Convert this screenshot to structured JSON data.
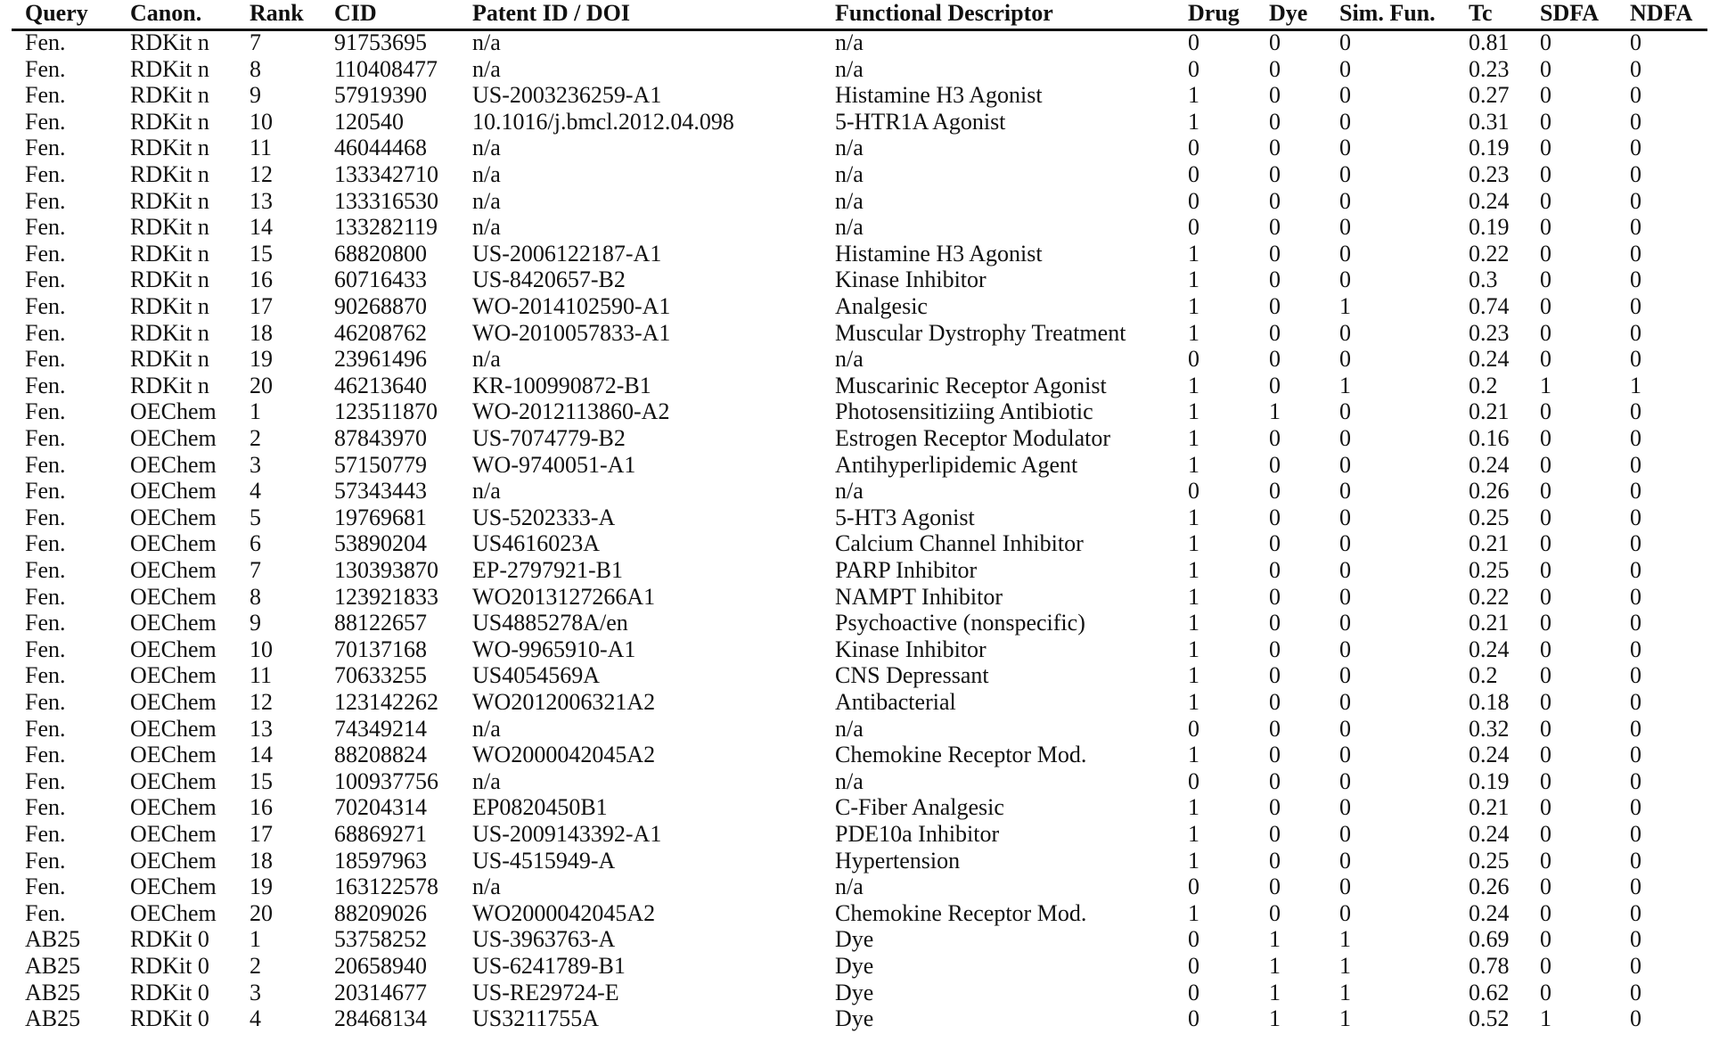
{
  "table": {
    "headers": [
      "Query",
      "Canon.",
      "Rank",
      "CID",
      "Patent ID / DOI",
      "Functional Descriptor",
      "Drug",
      "Dye",
      "Sim. Fun.",
      "Tc",
      "SDFA",
      "NDFA"
    ],
    "rows": [
      [
        "Fen.",
        "RDKit n",
        "7",
        "91753695",
        "n/a",
        "n/a",
        "0",
        "0",
        "0",
        "0.81",
        "0",
        "0"
      ],
      [
        "Fen.",
        "RDKit n",
        "8",
        "110408477",
        "n/a",
        "n/a",
        "0",
        "0",
        "0",
        "0.23",
        "0",
        "0"
      ],
      [
        "Fen.",
        "RDKit n",
        "9",
        "57919390",
        "US-2003236259-A1",
        "Histamine H3 Agonist",
        "1",
        "0",
        "0",
        "0.27",
        "0",
        "0"
      ],
      [
        "Fen.",
        "RDKit n",
        "10",
        "120540",
        "10.1016/j.bmcl.2012.04.098",
        "5-HTR1A Agonist",
        "1",
        "0",
        "0",
        "0.31",
        "0",
        "0"
      ],
      [
        "Fen.",
        "RDKit n",
        "11",
        "46044468",
        "n/a",
        "n/a",
        "0",
        "0",
        "0",
        "0.19",
        "0",
        "0"
      ],
      [
        "Fen.",
        "RDKit n",
        "12",
        "133342710",
        "n/a",
        "n/a",
        "0",
        "0",
        "0",
        "0.23",
        "0",
        "0"
      ],
      [
        "Fen.",
        "RDKit n",
        "13",
        "133316530",
        "n/a",
        "n/a",
        "0",
        "0",
        "0",
        "0.24",
        "0",
        "0"
      ],
      [
        "Fen.",
        "RDKit n",
        "14",
        "133282119",
        "n/a",
        "n/a",
        "0",
        "0",
        "0",
        "0.19",
        "0",
        "0"
      ],
      [
        "Fen.",
        "RDKit n",
        "15",
        "68820800",
        "US-2006122187-A1",
        "Histamine H3 Agonist",
        "1",
        "0",
        "0",
        "0.22",
        "0",
        "0"
      ],
      [
        "Fen.",
        "RDKit n",
        "16",
        "60716433",
        "US-8420657-B2",
        "Kinase Inhibitor",
        "1",
        "0",
        "0",
        "0.3",
        "0",
        "0"
      ],
      [
        "Fen.",
        "RDKit n",
        "17",
        "90268870",
        "WO-2014102590-A1",
        "Analgesic",
        "1",
        "0",
        "1",
        "0.74",
        "0",
        "0"
      ],
      [
        "Fen.",
        "RDKit n",
        "18",
        "46208762",
        "WO-2010057833-A1",
        "Muscular Dystrophy Treatment",
        "1",
        "0",
        "0",
        "0.23",
        "0",
        "0"
      ],
      [
        "Fen.",
        "RDKit n",
        "19",
        "23961496",
        "n/a",
        "n/a",
        "0",
        "0",
        "0",
        "0.24",
        "0",
        "0"
      ],
      [
        "Fen.",
        "RDKit n",
        "20",
        "46213640",
        "KR-100990872-B1",
        "Muscarinic Receptor Agonist",
        "1",
        "0",
        "1",
        "0.2",
        "1",
        "1"
      ],
      [
        "Fen.",
        "OEChem",
        "1",
        "123511870",
        "WO-2012113860-A2",
        "Photosensitiziing Antibiotic",
        "1",
        "1",
        "0",
        "0.21",
        "0",
        "0"
      ],
      [
        "Fen.",
        "OEChem",
        "2",
        "87843970",
        "US-7074779-B2",
        "Estrogen Receptor Modulator",
        "1",
        "0",
        "0",
        "0.16",
        "0",
        "0"
      ],
      [
        "Fen.",
        "OEChem",
        "3",
        "57150779",
        "WO-9740051-A1",
        "Antihyperlipidemic Agent",
        "1",
        "0",
        "0",
        "0.24",
        "0",
        "0"
      ],
      [
        "Fen.",
        "OEChem",
        "4",
        "57343443",
        "n/a",
        "n/a",
        "0",
        "0",
        "0",
        "0.26",
        "0",
        "0"
      ],
      [
        "Fen.",
        "OEChem",
        "5",
        "19769681",
        "US-5202333-A",
        "5-HT3 Agonist",
        "1",
        "0",
        "0",
        "0.25",
        "0",
        "0"
      ],
      [
        "Fen.",
        "OEChem",
        "6",
        "53890204",
        "US4616023A",
        "Calcium Channel Inhibitor",
        "1",
        "0",
        "0",
        "0.21",
        "0",
        "0"
      ],
      [
        "Fen.",
        "OEChem",
        "7",
        "130393870",
        "EP-2797921-B1",
        "PARP Inhibitor",
        "1",
        "0",
        "0",
        "0.25",
        "0",
        "0"
      ],
      [
        "Fen.",
        "OEChem",
        "8",
        "123921833",
        "WO2013127266A1",
        "NAMPT Inhibitor",
        "1",
        "0",
        "0",
        "0.22",
        "0",
        "0"
      ],
      [
        "Fen.",
        "OEChem",
        "9",
        "88122657",
        "US4885278A/en",
        "Psychoactive (nonspecific)",
        "1",
        "0",
        "0",
        "0.21",
        "0",
        "0"
      ],
      [
        "Fen.",
        "OEChem",
        "10",
        "70137168",
        "WO-9965910-A1",
        "Kinase Inhibitor",
        "1",
        "0",
        "0",
        "0.24",
        "0",
        "0"
      ],
      [
        "Fen.",
        "OEChem",
        "11",
        "70633255",
        "US4054569A",
        "CNS Depressant",
        "1",
        "0",
        "0",
        "0.2",
        "0",
        "0"
      ],
      [
        "Fen.",
        "OEChem",
        "12",
        "123142262",
        "WO2012006321A2",
        "Antibacterial",
        "1",
        "0",
        "0",
        "0.18",
        "0",
        "0"
      ],
      [
        "Fen.",
        "OEChem",
        "13",
        "74349214",
        "n/a",
        "n/a",
        "0",
        "0",
        "0",
        "0.32",
        "0",
        "0"
      ],
      [
        "Fen.",
        "OEChem",
        "14",
        "88208824",
        "WO2000042045A2",
        "Chemokine Receptor Mod.",
        "1",
        "0",
        "0",
        "0.24",
        "0",
        "0"
      ],
      [
        "Fen.",
        "OEChem",
        "15",
        "100937756",
        "n/a",
        "n/a",
        "0",
        "0",
        "0",
        "0.19",
        "0",
        "0"
      ],
      [
        "Fen.",
        "OEChem",
        "16",
        "70204314",
        "EP0820450B1",
        "C-Fiber Analgesic",
        "1",
        "0",
        "0",
        "0.21",
        "0",
        "0"
      ],
      [
        "Fen.",
        "OEChem",
        "17",
        "68869271",
        "US-2009143392-A1",
        "PDE10a Inhibitor",
        "1",
        "0",
        "0",
        "0.24",
        "0",
        "0"
      ],
      [
        "Fen.",
        "OEChem",
        "18",
        "18597963",
        "US-4515949-A",
        "Hypertension",
        "1",
        "0",
        "0",
        "0.25",
        "0",
        "0"
      ],
      [
        "Fen.",
        "OEChem",
        "19",
        "163122578",
        "n/a",
        "n/a",
        "0",
        "0",
        "0",
        "0.26",
        "0",
        "0"
      ],
      [
        "Fen.",
        "OEChem",
        "20",
        "88209026",
        "WO2000042045A2",
        "Chemokine Receptor Mod.",
        "1",
        "0",
        "0",
        "0.24",
        "0",
        "0"
      ],
      [
        "AB25",
        "RDKit 0",
        "1",
        "53758252",
        "US-3963763-A",
        "Dye",
        "0",
        "1",
        "1",
        "0.69",
        "0",
        "0"
      ],
      [
        "AB25",
        "RDKit 0",
        "2",
        "20658940",
        "US-6241789-B1",
        "Dye",
        "0",
        "1",
        "1",
        "0.78",
        "0",
        "0"
      ],
      [
        "AB25",
        "RDKit 0",
        "3",
        "20314677",
        "US-RE29724-E",
        "Dye",
        "0",
        "1",
        "1",
        "0.62",
        "0",
        "0"
      ],
      [
        "AB25",
        "RDKit 0",
        "4",
        "28468134",
        "US3211755A",
        "Dye",
        "0",
        "1",
        "1",
        "0.52",
        "1",
        "0"
      ]
    ]
  }
}
